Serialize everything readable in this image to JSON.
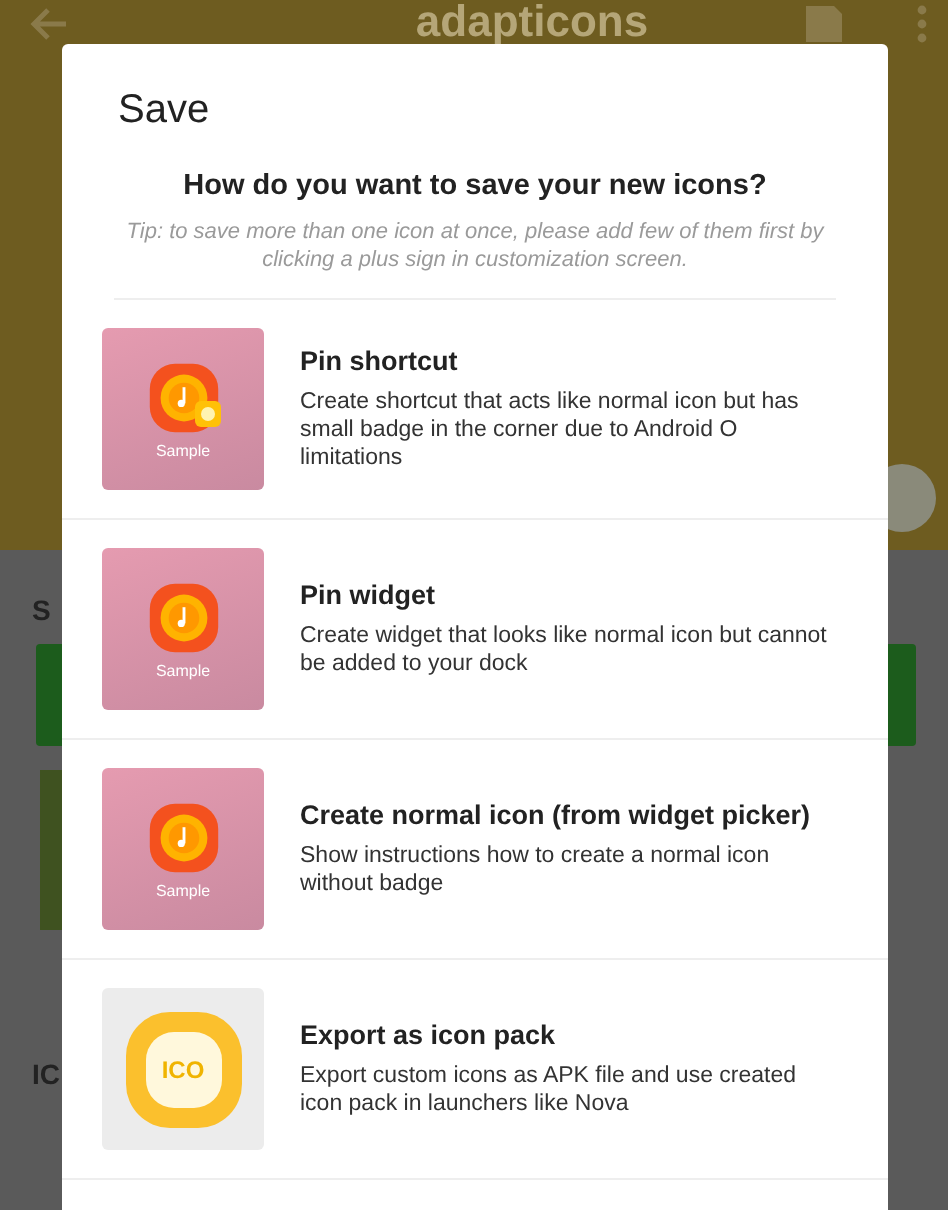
{
  "app_bar": {
    "title": "adapticons"
  },
  "background_sections": [
    {
      "label": "S"
    },
    {
      "label": "IC"
    }
  ],
  "dialog": {
    "title": "Save",
    "question": "How do you want to save your new icons?",
    "tip": "Tip: to save more than one icon at once, please add few of them first by clicking a plus sign in customization screen.",
    "options": [
      {
        "kind": "sample",
        "badge": true,
        "caption": "Sample",
        "title": "Pin shortcut",
        "description": "Create shortcut that acts like normal icon but has small badge in the corner due to Android O limitations"
      },
      {
        "kind": "sample",
        "badge": false,
        "caption": "Sample",
        "title": "Pin widget",
        "description": "Create widget that looks like normal icon but cannot be added to your dock"
      },
      {
        "kind": "sample",
        "badge": false,
        "caption": "Sample",
        "title": "Create normal icon (from widget picker)",
        "description": "Show instructions how to create a normal icon without badge"
      },
      {
        "kind": "pack",
        "badge": false,
        "caption": "ICO",
        "title": "Export as icon pack",
        "description": "Export custom icons as APK file and use created icon pack in launchers like Nova"
      }
    ]
  }
}
